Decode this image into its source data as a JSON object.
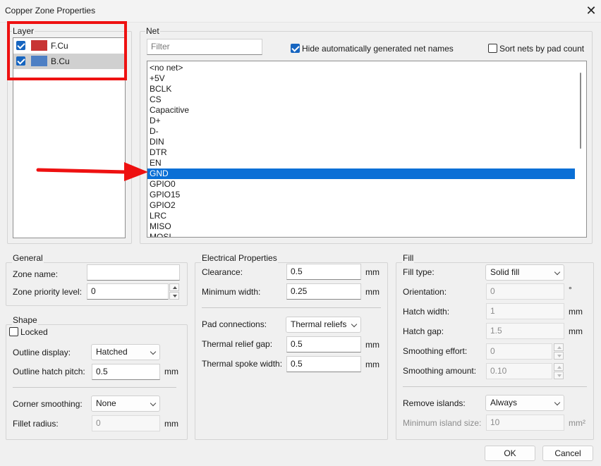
{
  "window": {
    "title": "Copper Zone Properties"
  },
  "layer": {
    "label": "Layer",
    "items": [
      {
        "name": "F.Cu",
        "color": "#c83434",
        "checked": true
      },
      {
        "name": "B.Cu",
        "color": "#4d7fc4",
        "checked": true
      }
    ]
  },
  "net": {
    "label": "Net",
    "filter_placeholder": "Filter",
    "hide_auto_label": "Hide automatically generated net names",
    "sort_by_pad_label": "Sort nets by pad count",
    "items": [
      "<no net>",
      "+5V",
      "BCLK",
      "CS",
      "Capacitive",
      "D+",
      "D-",
      "DIN",
      "DTR",
      "EN",
      "GND",
      "GPIO0",
      "GPIO15",
      "GPIO2",
      "LRC",
      "MISO",
      "MOSI"
    ],
    "selected": "GND"
  },
  "general": {
    "label": "General",
    "zone_name_label": "Zone name:",
    "zone_name_value": "",
    "priority_label": "Zone priority level:",
    "priority_value": "0"
  },
  "shape": {
    "label": "Shape",
    "locked_label": "Locked",
    "outline_display_label": "Outline display:",
    "outline_display_value": "Hatched",
    "hatch_pitch_label": "Outline hatch pitch:",
    "hatch_pitch_value": "0.5",
    "hatch_pitch_unit": "mm",
    "corner_smoothing_label": "Corner smoothing:",
    "corner_smoothing_value": "None",
    "fillet_radius_label": "Fillet radius:",
    "fillet_radius_value": "0",
    "fillet_radius_unit": "mm"
  },
  "electrical": {
    "label": "Electrical Properties",
    "clearance_label": "Clearance:",
    "clearance_value": "0.5",
    "min_width_label": "Minimum width:",
    "min_width_value": "0.25",
    "unit": "mm",
    "pad_connections_label": "Pad connections:",
    "pad_connections_value": "Thermal reliefs",
    "thermal_gap_label": "Thermal relief gap:",
    "thermal_gap_value": "0.5",
    "spoke_width_label": "Thermal spoke width:",
    "spoke_width_value": "0.5"
  },
  "fill": {
    "label": "Fill",
    "fill_type_label": "Fill type:",
    "fill_type_value": "Solid fill",
    "orientation_label": "Orientation:",
    "orientation_value": "0",
    "orientation_unit": "°",
    "hatch_width_label": "Hatch width:",
    "hatch_width_value": "1",
    "hatch_gap_label": "Hatch gap:",
    "hatch_gap_value": "1.5",
    "unit": "mm",
    "smoothing_effort_label": "Smoothing effort:",
    "smoothing_effort_value": "0",
    "smoothing_amount_label": "Smoothing amount:",
    "smoothing_amount_value": "0.10",
    "remove_islands_label": "Remove islands:",
    "remove_islands_value": "Always",
    "min_island_label": "Minimum island size:",
    "min_island_value": "10",
    "min_island_unit": "mm²"
  },
  "buttons": {
    "ok": "OK",
    "cancel": "Cancel"
  },
  "annotation": {
    "color": "#ee1111"
  }
}
